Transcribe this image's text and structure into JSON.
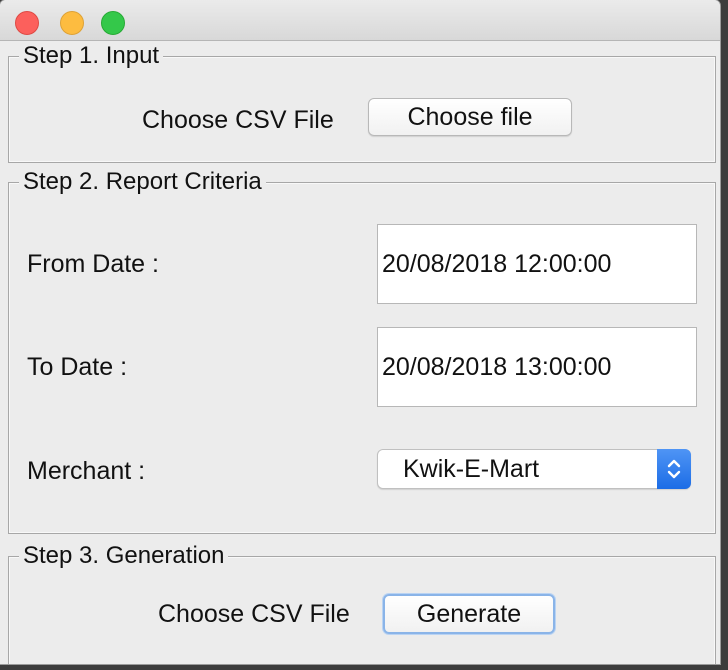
{
  "window": {
    "controls": {
      "close": "close-icon",
      "minimize": "minimize-icon",
      "zoom": "zoom-icon"
    }
  },
  "step1": {
    "title": "Step 1. Input",
    "label": "Choose CSV File",
    "button": "Choose file"
  },
  "step2": {
    "title": "Step 2. Report Criteria",
    "from_label": "From Date :",
    "from_value": "20/08/2018 12:00:00",
    "to_label": "To Date :",
    "to_value": "20/08/2018 13:00:00",
    "merchant_label": "Merchant :",
    "merchant_value": "Kwik-E-Mart",
    "merchant_icon": "chevron-up-down-icon"
  },
  "step3": {
    "title": "Step 3. Generation",
    "label": "Choose CSV File",
    "button": "Generate"
  },
  "colors": {
    "window_bg": "#ececec",
    "close": "#fc605c",
    "minimize": "#fdbc40",
    "zoom": "#34c84a",
    "select_accent": "#1c6de6",
    "focus_ring": "#8ab4e8"
  }
}
